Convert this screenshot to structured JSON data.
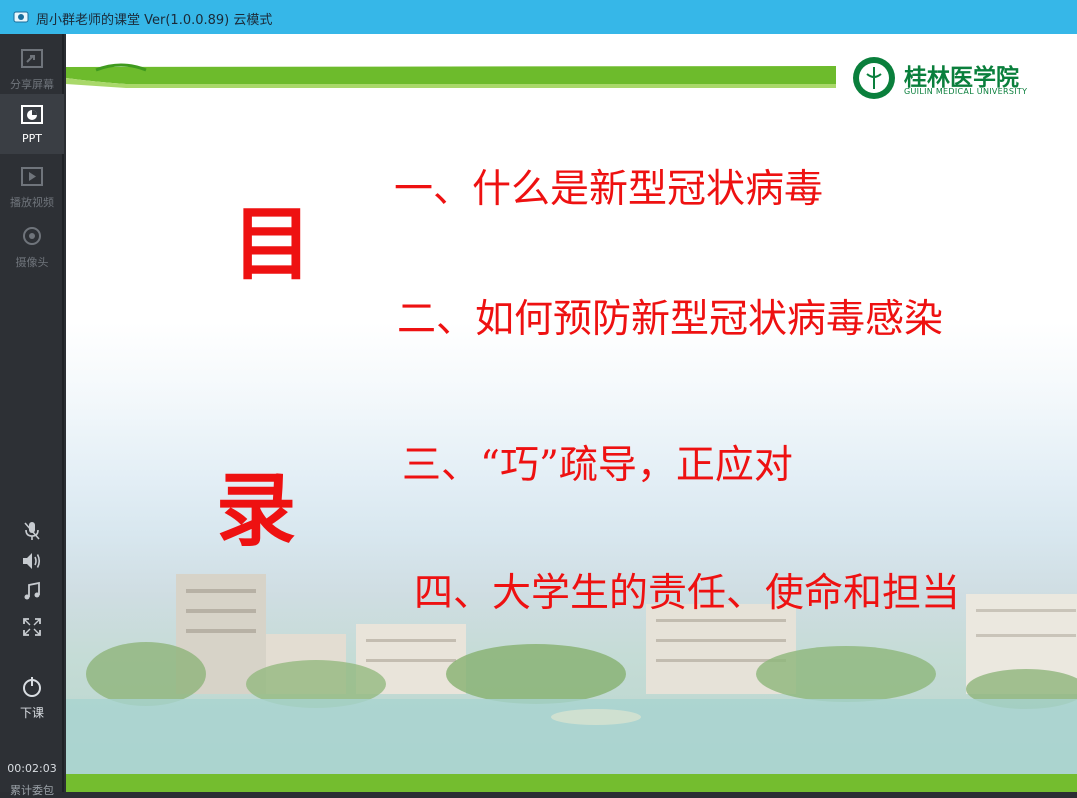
{
  "window": {
    "title": "周小群老师的课堂 Ver(1.0.0.89)  云模式"
  },
  "sidebar": {
    "items": [
      {
        "label": "分享屏幕",
        "icon": "share-screen-icon"
      },
      {
        "label": "PPT",
        "icon": "ppt-icon"
      },
      {
        "label": "播放视频",
        "icon": "play-video-icon"
      },
      {
        "label": "摄像头",
        "icon": "camera-icon"
      }
    ],
    "controls": [
      "mic-muted-icon",
      "speaker-icon",
      "music-icon",
      "fullscreen-icon"
    ],
    "end_class_label": "下课",
    "timer": "00:02:03",
    "cumulative_label": "累计委包"
  },
  "slide": {
    "heading_char_1": "目",
    "heading_char_2": "录",
    "items": [
      "一、什么是新型冠状病毒",
      "二、如何预防新型冠状病毒感染",
      "三、“巧”疏导，正应对",
      "四、大学生的责任、使命和担当"
    ],
    "logo_text": "桂林医学院",
    "logo_subtext": "GUILIN MEDICAL UNIVERSITY",
    "accent_color": "#ee1111",
    "brand_color": "#0a7f3c"
  }
}
